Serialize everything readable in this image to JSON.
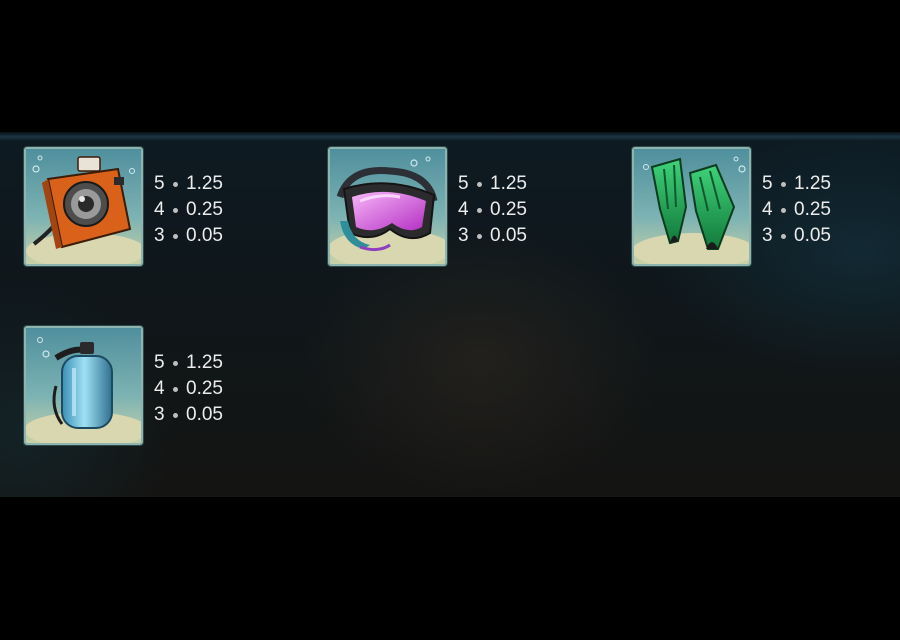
{
  "paytable": {
    "symbols": [
      {
        "id": "camera",
        "icon": "underwater-camera-icon",
        "payouts": [
          {
            "count": "5",
            "amount": "1.25"
          },
          {
            "count": "4",
            "amount": "0.25"
          },
          {
            "count": "3",
            "amount": "0.05"
          }
        ]
      },
      {
        "id": "mask",
        "icon": "diving-mask-icon",
        "payouts": [
          {
            "count": "5",
            "amount": "1.25"
          },
          {
            "count": "4",
            "amount": "0.25"
          },
          {
            "count": "3",
            "amount": "0.05"
          }
        ]
      },
      {
        "id": "fins",
        "icon": "diving-fins-icon",
        "payouts": [
          {
            "count": "5",
            "amount": "1.25"
          },
          {
            "count": "4",
            "amount": "0.25"
          },
          {
            "count": "3",
            "amount": "0.05"
          }
        ]
      },
      {
        "id": "tank",
        "icon": "oxygen-tank-icon",
        "payouts": [
          {
            "count": "5",
            "amount": "1.25"
          },
          {
            "count": "4",
            "amount": "0.25"
          },
          {
            "count": "3",
            "amount": "0.05"
          }
        ]
      }
    ]
  },
  "colors": {
    "camera": "#e0661e",
    "mask": "#d84fd8",
    "fins": "#2fae5c",
    "tank": "#6ec4e0",
    "tile_border": "#8fb3ae",
    "payout_text": "#ececec"
  }
}
